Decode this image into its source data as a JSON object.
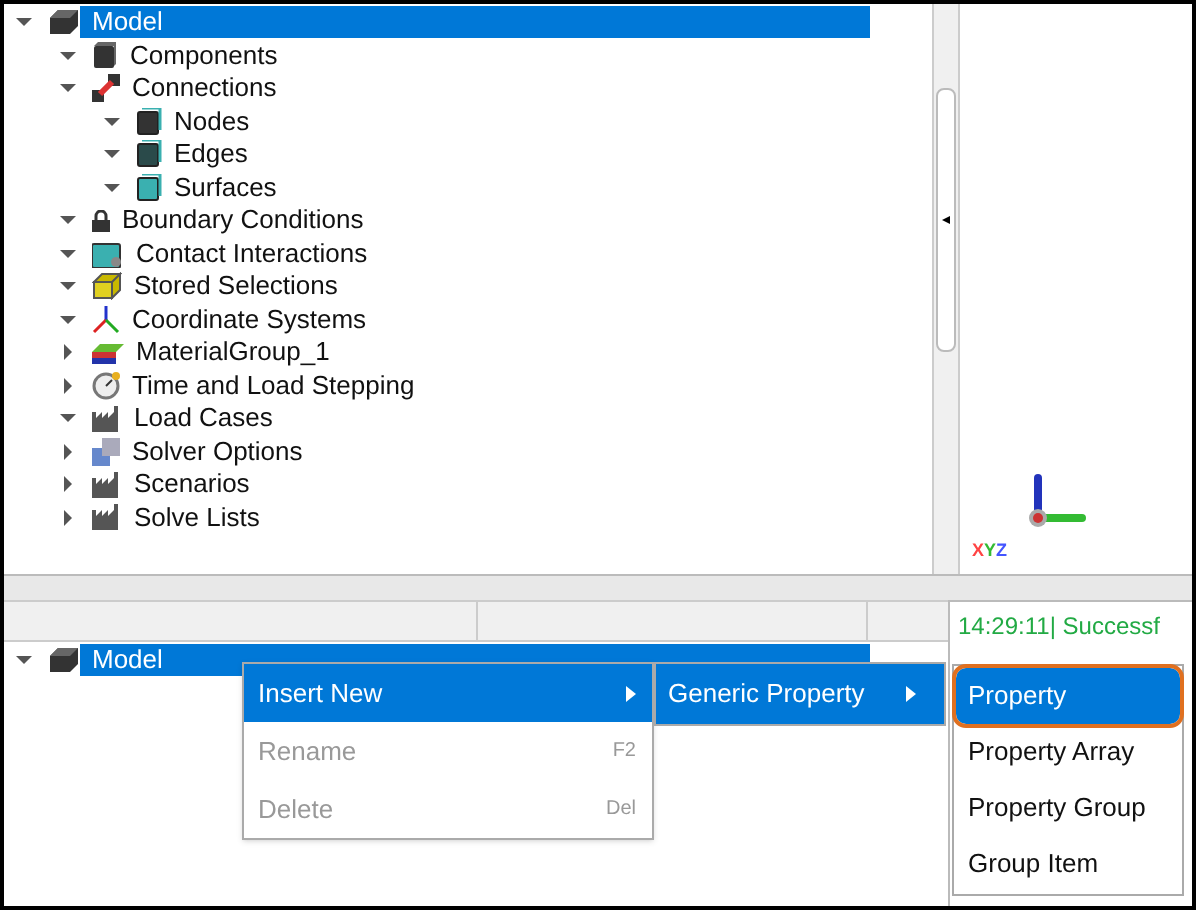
{
  "model_tree": [
    {
      "label": "Model",
      "expanded": true,
      "selected": true,
      "children": [
        {
          "label": "Components",
          "expanded": true,
          "selected": false
        },
        {
          "label": "Connections",
          "expanded": true,
          "selected": false,
          "children": [
            {
              "label": "Nodes",
              "expanded": true,
              "selected": false
            },
            {
              "label": "Edges",
              "expanded": true,
              "selected": false
            },
            {
              "label": "Surfaces",
              "expanded": true,
              "selected": false
            }
          ]
        },
        {
          "label": "Boundary Conditions",
          "expanded": true,
          "selected": false
        },
        {
          "label": "Contact Interactions",
          "expanded": true,
          "selected": false
        },
        {
          "label": "Stored Selections",
          "expanded": true,
          "selected": false
        },
        {
          "label": "Coordinate Systems",
          "expanded": true,
          "selected": false
        },
        {
          "label": "MaterialGroup_1",
          "expanded": false,
          "selected": false
        },
        {
          "label": "Time and Load Stepping",
          "expanded": false,
          "selected": false
        },
        {
          "label": "Load Cases",
          "expanded": true,
          "selected": false
        },
        {
          "label": "Solver Options",
          "expanded": false,
          "selected": false
        },
        {
          "label": "Scenarios",
          "expanded": false,
          "selected": false
        },
        {
          "label": "Solve Lists",
          "expanded": false,
          "selected": false
        }
      ]
    }
  ],
  "viewport": {
    "axis_label": "XYZ"
  },
  "lower_tree": [
    {
      "label": "Model",
      "expanded": true,
      "selected": true
    }
  ],
  "log": [
    "14:29:11| Successf"
  ],
  "context_menu": [
    {
      "label": "Insert New",
      "disabled": false,
      "selected": true,
      "submenu": true
    },
    {
      "label": "Rename",
      "shortcut": "F2",
      "disabled": true,
      "selected": false,
      "submenu": false
    },
    {
      "label": "Delete",
      "shortcut": "Del",
      "disabled": true,
      "selected": false,
      "submenu": false
    }
  ],
  "submenu": [
    {
      "label": "Generic Property",
      "selected": true,
      "submenu": true
    }
  ],
  "property_menu": [
    {
      "label": "Property",
      "selected": true
    },
    {
      "label": "Property Array",
      "selected": false
    },
    {
      "label": "Property Group",
      "selected": false
    },
    {
      "label": "Group Item",
      "selected": false
    }
  ]
}
